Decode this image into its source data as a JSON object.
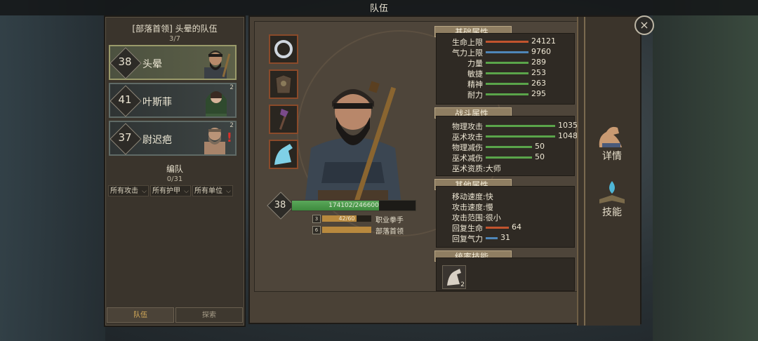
{
  "window": {
    "title": "队伍",
    "close": "×"
  },
  "team": {
    "title": "[部落首领] 头晕的队伍",
    "count": "3/7",
    "units": [
      {
        "level": "38",
        "name": "头晕",
        "badge": "",
        "alert": false,
        "selected": true
      },
      {
        "level": "41",
        "name": "叶斯菲",
        "badge": "2",
        "alert": false,
        "selected": false
      },
      {
        "level": "37",
        "name": "尉迟疤",
        "badge": "2",
        "alert": true,
        "selected": false
      }
    ]
  },
  "formation": {
    "title": "编队",
    "count": "0/31",
    "filters": [
      "所有攻击",
      "所有护甲",
      "所有单位"
    ]
  },
  "tabs": [
    "队伍",
    "探索"
  ],
  "hero": {
    "level": "38",
    "exp_text": "174102/246600",
    "exp_fraction": 0.706,
    "profession": {
      "value": "42/60",
      "fraction": 0.7,
      "label": "职业拳手",
      "icon": "3"
    },
    "rank": {
      "value": "",
      "fraction": 1.0,
      "label": "部落首领",
      "icon": "6"
    }
  },
  "basic_stats": {
    "header": "基础属性",
    "rows": [
      {
        "label": "生命上限",
        "value": "24121",
        "color": "#c2542e",
        "fraction": 0.55
      },
      {
        "label": "气力上限",
        "value": "9760",
        "color": "#4f86b8",
        "fraction": 0.55
      },
      {
        "label": "力量",
        "value": "289",
        "color": "#5aa44a",
        "fraction": 0.55
      },
      {
        "label": "敏捷",
        "value": "253",
        "color": "#5aa44a",
        "fraction": 0.55
      },
      {
        "label": "精神",
        "value": "263",
        "color": "#5aa44a",
        "fraction": 0.55
      },
      {
        "label": "耐力",
        "value": "295",
        "color": "#5aa44a",
        "fraction": 0.55
      }
    ]
  },
  "combat_stats": {
    "header": "战斗属性",
    "rows": [
      {
        "label": "物理攻击",
        "value": "1035",
        "color": "#5aa44a",
        "fraction": 0.9
      },
      {
        "label": "巫术攻击",
        "value": "1048",
        "color": "#5aa44a",
        "fraction": 0.9
      },
      {
        "label": "物理减伤",
        "value": "50",
        "color": "#5aa44a",
        "fraction": 0.6
      },
      {
        "label": "巫术减伤",
        "value": "50",
        "color": "#5aa44a",
        "fraction": 0.6
      }
    ],
    "aptitude": {
      "label": "巫术资质",
      "value": ":大师"
    }
  },
  "other_stats": {
    "header": "其他属性",
    "text_rows": [
      {
        "label": "移动速度",
        "value": ":快"
      },
      {
        "label": "攻击速度",
        "value": ":慢"
      },
      {
        "label": "攻击范围",
        "value": ":很小"
      }
    ],
    "bar_rows": [
      {
        "label": "回复生命",
        "value": "64",
        "color": "#c2542e",
        "fraction": 0.3
      },
      {
        "label": "回复气力",
        "value": "31",
        "color": "#4f86b8",
        "fraction": 0.15
      }
    ]
  },
  "command_skills": {
    "header": "统率技能",
    "skill_count": "2"
  },
  "rail": {
    "details": "详情",
    "skills": "技能"
  }
}
